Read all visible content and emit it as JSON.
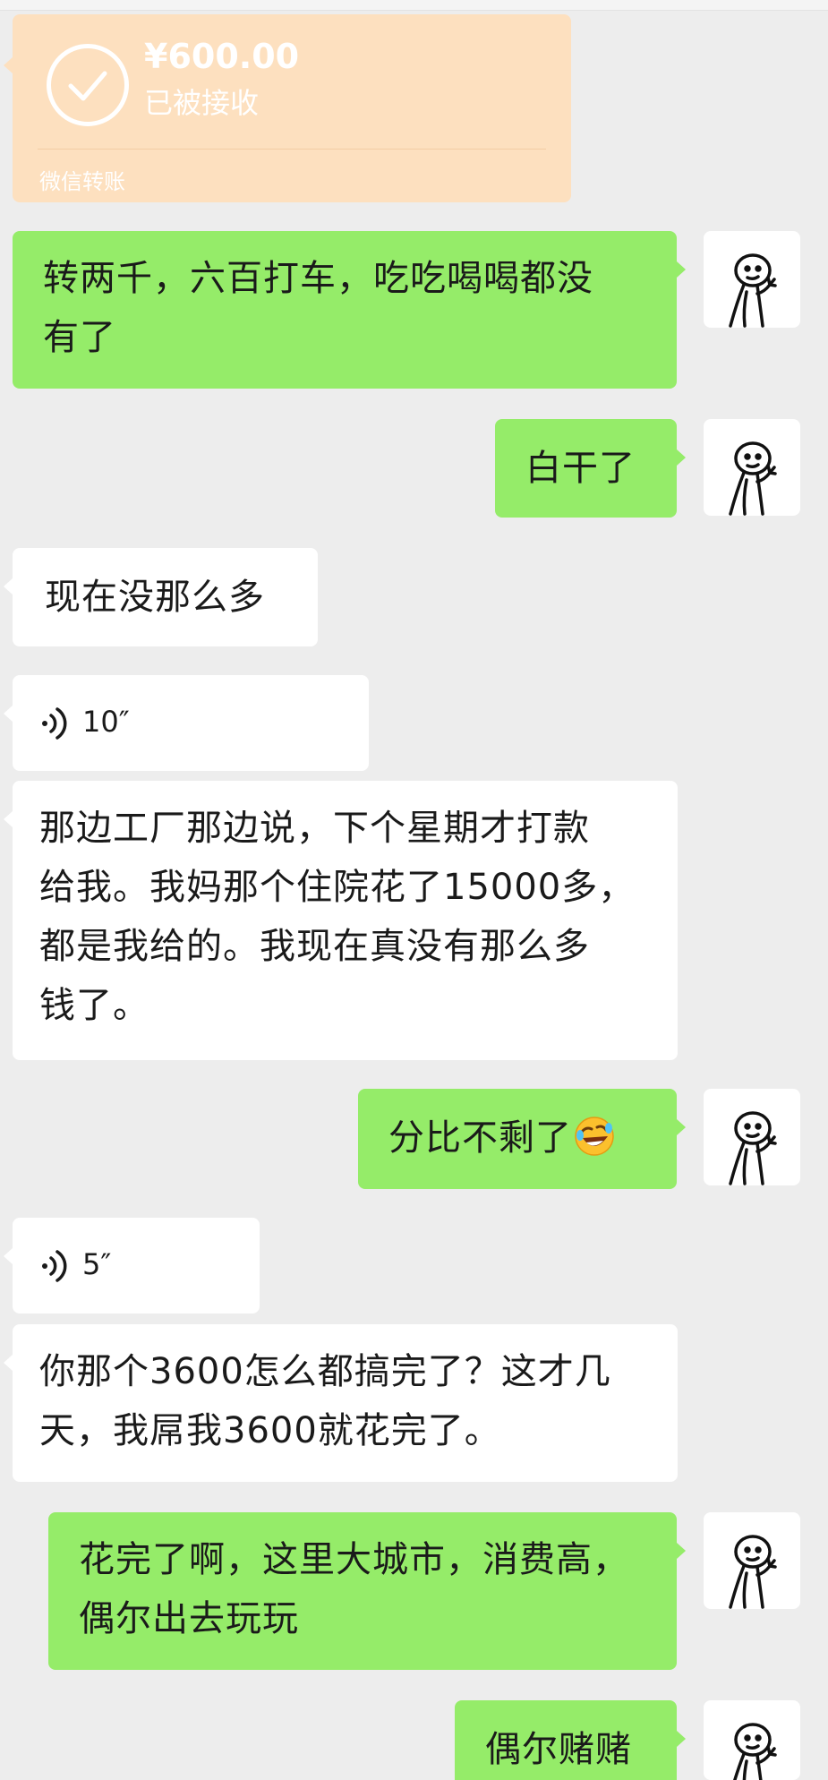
{
  "transfer": {
    "amount": "¥600.00",
    "status": "已被接收",
    "label": "微信转账"
  },
  "messages": [
    {
      "side": "right",
      "type": "text",
      "text": "转两千，六百打车，吃吃喝喝都没\n有了"
    },
    {
      "side": "right",
      "type": "text",
      "text": "白干了"
    },
    {
      "side": "left",
      "type": "text",
      "text": "现在没那么多"
    },
    {
      "side": "left",
      "type": "voice",
      "duration": "10″"
    },
    {
      "side": "left",
      "type": "text",
      "text": "那边工厂那边说，下个星期才打款\n给我。我妈那个住院花了15000多，\n都是我给的。我现在真没有那么多\n钱了。"
    },
    {
      "side": "right",
      "type": "text",
      "text": "分比不剩了",
      "emoji": "rolling-on-floor-laughing-emoji"
    },
    {
      "side": "left",
      "type": "voice",
      "duration": "5″"
    },
    {
      "side": "left",
      "type": "text",
      "text": "你那个3600怎么都搞完了？这才几\n天，我屌我3600就花完了。"
    },
    {
      "side": "right",
      "type": "text",
      "text": "花完了啊，这里大城市，消费高，\n偶尔出去玩玩"
    },
    {
      "side": "right",
      "type": "text",
      "text": "偶尔赌赌"
    }
  ],
  "avatar_icon": "stick-figure-avatar-icon",
  "colors": {
    "background": "#ededed",
    "outgoing_bubble": "#95ec69",
    "incoming_bubble": "#ffffff",
    "transfer_bubble": "#fde0bf"
  }
}
